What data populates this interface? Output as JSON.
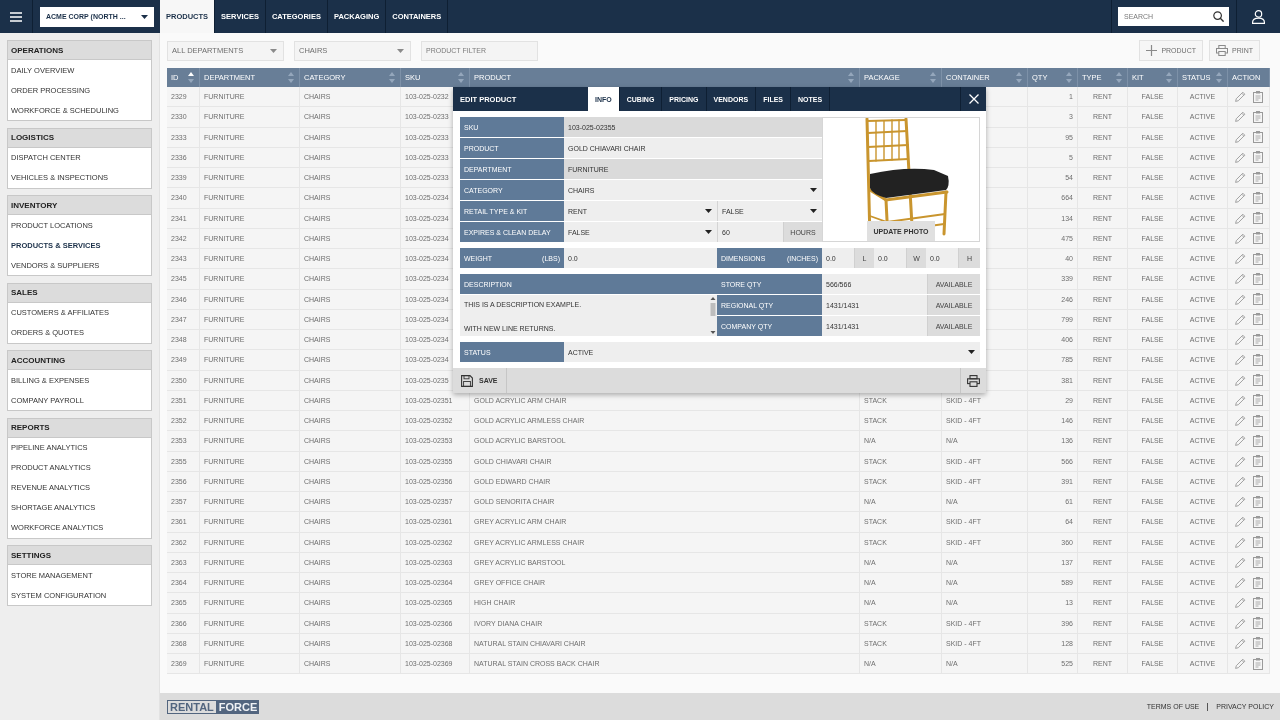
{
  "top_bar": {
    "company": "ACME CORP (NORTH ...",
    "tabs": [
      {
        "label": "PRODUCTS",
        "selected": true
      },
      {
        "label": "SERVICES",
        "selected": false
      },
      {
        "label": "CATEGORIES",
        "selected": false
      },
      {
        "label": "PACKAGING",
        "selected": false
      },
      {
        "label": "CONTAINERS",
        "selected": false
      }
    ],
    "search": {
      "placeholder": "SEARCH"
    }
  },
  "sidebar": {
    "sections": [
      {
        "title": "OPERATIONS",
        "items": [
          {
            "label": "DAILY OVERVIEW",
            "selected": false
          },
          {
            "label": "ORDER PROCESSING",
            "selected": false
          },
          {
            "label": "WORKFORCE & SCHEDULING",
            "selected": false
          }
        ]
      },
      {
        "title": "LOGISTICS",
        "items": [
          {
            "label": "DISPATCH CENTER",
            "selected": false
          },
          {
            "label": "VEHICLES & INSPECTIONS",
            "selected": false
          }
        ]
      },
      {
        "title": "INVENTORY",
        "items": [
          {
            "label": "PRODUCT LOCATIONS",
            "selected": false
          },
          {
            "label": "PRODUCTS & SERVICES",
            "selected": true
          },
          {
            "label": "VENDORS & SUPPLIERS",
            "selected": false
          }
        ]
      },
      {
        "title": "SALES",
        "items": [
          {
            "label": "CUSTOMERS & AFFILIATES",
            "selected": false
          },
          {
            "label": "ORDERS & QUOTES",
            "selected": false
          }
        ]
      },
      {
        "title": "ACCOUNTING",
        "items": [
          {
            "label": "BILLING & EXPENSES",
            "selected": false
          },
          {
            "label": "COMPANY PAYROLL",
            "selected": false
          }
        ]
      },
      {
        "title": "REPORTS",
        "items": [
          {
            "label": "PIPELINE ANALYTICS",
            "selected": false
          },
          {
            "label": "PRODUCT ANALYTICS",
            "selected": false
          },
          {
            "label": "REVENUE ANALYTICS",
            "selected": false
          },
          {
            "label": "SHORTAGE ANALYTICS",
            "selected": false
          },
          {
            "label": "WORKFORCE ANALYTICS",
            "selected": false
          }
        ]
      },
      {
        "title": "SETTINGS",
        "items": [
          {
            "label": "STORE MANAGEMENT",
            "selected": false
          },
          {
            "label": "SYSTEM CONFIGURATION",
            "selected": false
          }
        ]
      }
    ]
  },
  "toolbar": {
    "filters": [
      {
        "kind": "dropdown",
        "value": "ALL DEPARTMENTS"
      },
      {
        "kind": "dropdown",
        "value": "CHAIRS"
      },
      {
        "kind": "text",
        "placeholder": "PRODUCT FILTER"
      }
    ],
    "buttons": [
      {
        "kind": "add",
        "label": "PRODUCT"
      },
      {
        "kind": "print",
        "label": "PRINT"
      }
    ]
  },
  "table": {
    "columns": [
      {
        "label": "ID",
        "sort_arrows": true,
        "sorted_ascending": true
      },
      {
        "label": "DEPARTMENT",
        "sort_arrows": true,
        "sorted_ascending": false
      },
      {
        "label": "CATEGORY",
        "sort_arrows": true,
        "sorted_ascending": false
      },
      {
        "label": "SKU",
        "sort_arrows": true,
        "sorted_ascending": false
      },
      {
        "label": "PRODUCT",
        "sort_arrows": true,
        "sorted_ascending": false
      },
      {
        "label": "PACKAGE",
        "sort_arrows": true,
        "sorted_ascending": false
      },
      {
        "label": "CONTAINER",
        "sort_arrows": true,
        "sorted_ascending": false
      },
      {
        "label": "QTY",
        "sort_arrows": true,
        "sorted_ascending": false
      },
      {
        "label": "TYPE",
        "sort_arrows": true,
        "sorted_ascending": false
      },
      {
        "label": "KIT",
        "sort_arrows": true,
        "sorted_ascending": false
      },
      {
        "label": "STATUS",
        "sort_arrows": true,
        "sorted_ascending": false
      },
      {
        "label": "ACTION",
        "sort_arrows": false
      }
    ],
    "rows": [
      {
        "id": "2329",
        "department": "FURNITURE",
        "category": "CHAIRS",
        "sku": "103-025-0232",
        "qty": "1",
        "type": "RENT",
        "kit": "FALSE",
        "status": "ACTIVE"
      },
      {
        "id": "2330",
        "department": "FURNITURE",
        "category": "CHAIRS",
        "sku": "103-025-0233",
        "qty": "3",
        "type": "RENT",
        "kit": "FALSE",
        "status": "ACTIVE"
      },
      {
        "id": "2333",
        "department": "FURNITURE",
        "category": "CHAIRS",
        "sku": "103-025-0233",
        "qty": "95",
        "type": "RENT",
        "kit": "FALSE",
        "status": "ACTIVE"
      },
      {
        "id": "2336",
        "department": "FURNITURE",
        "category": "CHAIRS",
        "sku": "103-025-0233",
        "qty": "5",
        "type": "RENT",
        "kit": "FALSE",
        "status": "ACTIVE"
      },
      {
        "id": "2339",
        "department": "FURNITURE",
        "category": "CHAIRS",
        "sku": "103-025-0233",
        "qty": "54",
        "type": "RENT",
        "kit": "FALSE",
        "status": "ACTIVE"
      },
      {
        "id": "2340",
        "department": "FURNITURE",
        "category": "CHAIRS",
        "sku": "103-025-0234",
        "qty": "664",
        "type": "RENT",
        "kit": "FALSE",
        "status": "ACTIVE"
      },
      {
        "id": "2341",
        "department": "FURNITURE",
        "category": "CHAIRS",
        "sku": "103-025-0234",
        "qty": "134",
        "type": "RENT",
        "kit": "FALSE",
        "status": "ACTIVE"
      },
      {
        "id": "2342",
        "department": "FURNITURE",
        "category": "CHAIRS",
        "sku": "103-025-0234",
        "qty": "475",
        "type": "RENT",
        "kit": "FALSE",
        "status": "ACTIVE"
      },
      {
        "id": "2343",
        "department": "FURNITURE",
        "category": "CHAIRS",
        "sku": "103-025-0234",
        "qty": "40",
        "type": "RENT",
        "kit": "FALSE",
        "status": "ACTIVE"
      },
      {
        "id": "2345",
        "department": "FURNITURE",
        "category": "CHAIRS",
        "sku": "103-025-0234",
        "qty": "339",
        "type": "RENT",
        "kit": "FALSE",
        "status": "ACTIVE"
      },
      {
        "id": "2346",
        "department": "FURNITURE",
        "category": "CHAIRS",
        "sku": "103-025-0234",
        "qty": "246",
        "type": "RENT",
        "kit": "FALSE",
        "status": "ACTIVE"
      },
      {
        "id": "2347",
        "department": "FURNITURE",
        "category": "CHAIRS",
        "sku": "103-025-0234",
        "qty": "799",
        "type": "RENT",
        "kit": "FALSE",
        "status": "ACTIVE"
      },
      {
        "id": "2348",
        "department": "FURNITURE",
        "category": "CHAIRS",
        "sku": "103-025-0234",
        "qty": "406",
        "type": "RENT",
        "kit": "FALSE",
        "status": "ACTIVE"
      },
      {
        "id": "2349",
        "department": "FURNITURE",
        "category": "CHAIRS",
        "sku": "103-025-0234",
        "qty": "785",
        "type": "RENT",
        "kit": "FALSE",
        "status": "ACTIVE"
      },
      {
        "id": "2350",
        "department": "FURNITURE",
        "category": "CHAIRS",
        "sku": "103-025-0235",
        "qty": "381",
        "type": "RENT",
        "kit": "FALSE",
        "status": "ACTIVE"
      },
      {
        "id": "2351",
        "department": "FURNITURE",
        "category": "CHAIRS",
        "sku": "103-025-02351",
        "product": "GOLD ACRYLIC ARM CHAIR",
        "package": "STACK",
        "container": "SKID - 4FT",
        "qty": "29",
        "type": "RENT",
        "kit": "FALSE",
        "status": "ACTIVE"
      },
      {
        "id": "2352",
        "department": "FURNITURE",
        "category": "CHAIRS",
        "sku": "103-025-02352",
        "product": "GOLD ACRYLIC ARMLESS CHAIR",
        "package": "STACK",
        "container": "SKID - 4FT",
        "qty": "146",
        "type": "RENT",
        "kit": "FALSE",
        "status": "ACTIVE"
      },
      {
        "id": "2353",
        "department": "FURNITURE",
        "category": "CHAIRS",
        "sku": "103-025-02353",
        "product": "GOLD ACRYLIC BARSTOOL",
        "package": "N/A",
        "container": "N/A",
        "qty": "136",
        "type": "RENT",
        "kit": "FALSE",
        "status": "ACTIVE"
      },
      {
        "id": "2355",
        "department": "FURNITURE",
        "category": "CHAIRS",
        "sku": "103-025-02355",
        "product": "GOLD CHIAVARI CHAIR",
        "package": "STACK",
        "container": "SKID - 4FT",
        "qty": "566",
        "type": "RENT",
        "kit": "FALSE",
        "status": "ACTIVE"
      },
      {
        "id": "2356",
        "department": "FURNITURE",
        "category": "CHAIRS",
        "sku": "103-025-02356",
        "product": "GOLD EDWARD CHAIR",
        "package": "STACK",
        "container": "SKID - 4FT",
        "qty": "391",
        "type": "RENT",
        "kit": "FALSE",
        "status": "ACTIVE"
      },
      {
        "id": "2357",
        "department": "FURNITURE",
        "category": "CHAIRS",
        "sku": "103-025-02357",
        "product": "GOLD SENORITA CHAIR",
        "package": "N/A",
        "container": "N/A",
        "qty": "61",
        "type": "RENT",
        "kit": "FALSE",
        "status": "ACTIVE"
      },
      {
        "id": "2361",
        "department": "FURNITURE",
        "category": "CHAIRS",
        "sku": "103-025-02361",
        "product": "GREY ACRYLIC ARM CHAIR",
        "package": "STACK",
        "container": "SKID - 4FT",
        "qty": "64",
        "type": "RENT",
        "kit": "FALSE",
        "status": "ACTIVE"
      },
      {
        "id": "2362",
        "department": "FURNITURE",
        "category": "CHAIRS",
        "sku": "103-025-02362",
        "product": "GREY ACRYLIC ARMLESS CHAIR",
        "package": "STACK",
        "container": "SKID - 4FT",
        "qty": "360",
        "type": "RENT",
        "kit": "FALSE",
        "status": "ACTIVE"
      },
      {
        "id": "2363",
        "department": "FURNITURE",
        "category": "CHAIRS",
        "sku": "103-025-02363",
        "product": "GREY ACRYLIC BARSTOOL",
        "package": "N/A",
        "container": "N/A",
        "qty": "137",
        "type": "RENT",
        "kit": "FALSE",
        "status": "ACTIVE"
      },
      {
        "id": "2364",
        "department": "FURNITURE",
        "category": "CHAIRS",
        "sku": "103-025-02364",
        "product": "GREY OFFICE CHAIR",
        "package": "N/A",
        "container": "N/A",
        "qty": "589",
        "type": "RENT",
        "kit": "FALSE",
        "status": "ACTIVE"
      },
      {
        "id": "2365",
        "department": "FURNITURE",
        "category": "CHAIRS",
        "sku": "103-025-02365",
        "product": "HIGH CHAIR",
        "package": "N/A",
        "container": "N/A",
        "qty": "13",
        "type": "RENT",
        "kit": "FALSE",
        "status": "ACTIVE"
      },
      {
        "id": "2366",
        "department": "FURNITURE",
        "category": "CHAIRS",
        "sku": "103-025-02366",
        "product": "IVORY DIANA CHAIR",
        "package": "STACK",
        "container": "SKID - 4FT",
        "qty": "396",
        "type": "RENT",
        "kit": "FALSE",
        "status": "ACTIVE"
      },
      {
        "id": "2368",
        "department": "FURNITURE",
        "category": "CHAIRS",
        "sku": "103-025-02368",
        "product": "NATURAL STAIN CHIAVARI CHAIR",
        "package": "STACK",
        "container": "SKID - 4FT",
        "qty": "128",
        "type": "RENT",
        "kit": "FALSE",
        "status": "ACTIVE"
      },
      {
        "id": "2369",
        "department": "FURNITURE",
        "category": "CHAIRS",
        "sku": "103-025-02369",
        "product": "NATURAL STAIN CROSS BACK CHAIR",
        "package": "N/A",
        "container": "N/A",
        "qty": "525",
        "type": "RENT",
        "kit": "FALSE",
        "status": "ACTIVE"
      }
    ]
  },
  "edit_dialog": {
    "title": "EDIT PRODUCT",
    "tabs": [
      {
        "label": "INFO",
        "selected": true
      },
      {
        "label": "CUBING",
        "selected": false
      },
      {
        "label": "PRICING",
        "selected": false
      },
      {
        "label": "VENDORS",
        "selected": false
      },
      {
        "label": "FILES",
        "selected": false
      },
      {
        "label": "NOTES",
        "selected": false
      }
    ],
    "fields": [
      {
        "label": "SKU",
        "kind": "readonly",
        "value": "103-025-02355"
      },
      {
        "label": "PRODUCT",
        "kind": "text",
        "value": "GOLD CHIAVARI CHAIR"
      },
      {
        "label": "DEPARTMENT",
        "kind": "readonly",
        "value": "FURNITURE"
      },
      {
        "label": "CATEGORY",
        "kind": "select",
        "value": "CHAIRS"
      },
      {
        "label": "RETAIL TYPE & KIT",
        "kind": "select_pair",
        "values": [
          "RENT",
          "FALSE"
        ]
      },
      {
        "label": "EXPIRES & CLEAN DELAY",
        "kind": "select_number",
        "value": "FALSE",
        "number": "60",
        "unit": "HOURS"
      }
    ],
    "photo_button": "UPDATE PHOTO",
    "weight": {
      "label": "WEIGHT",
      "unit": "(LBS)",
      "value": "0.0"
    },
    "dimensions": {
      "label": "DIMENSIONS",
      "unit": "(INCHES)",
      "fields": [
        {
          "value": "0.0",
          "axis": "L"
        },
        {
          "value": "0.0",
          "axis": "W"
        },
        {
          "value": "0.0",
          "axis": "H"
        }
      ]
    },
    "description": {
      "label": "DESCRIPTION",
      "value": "THIS IS A DESCRIPTION EXAMPLE.\n\nWITH NEW LINE RETURNS."
    },
    "quantities": [
      {
        "label": "STORE QTY",
        "value": "566/566",
        "availability": "AVAILABLE"
      },
      {
        "label": "REGIONAL QTY",
        "value": "1431/1431",
        "availability": "AVAILABLE"
      },
      {
        "label": "COMPANY QTY",
        "value": "1431/1431",
        "availability": "AVAILABLE"
      }
    ],
    "status": {
      "label": "STATUS",
      "value": "ACTIVE"
    },
    "save_label": "SAVE"
  },
  "footer": {
    "logo": {
      "part_1": "RENTAL",
      "part_2": "FORCE"
    },
    "links": [
      "TERMS OF USE",
      "PRIVACY POLICY"
    ]
  }
}
